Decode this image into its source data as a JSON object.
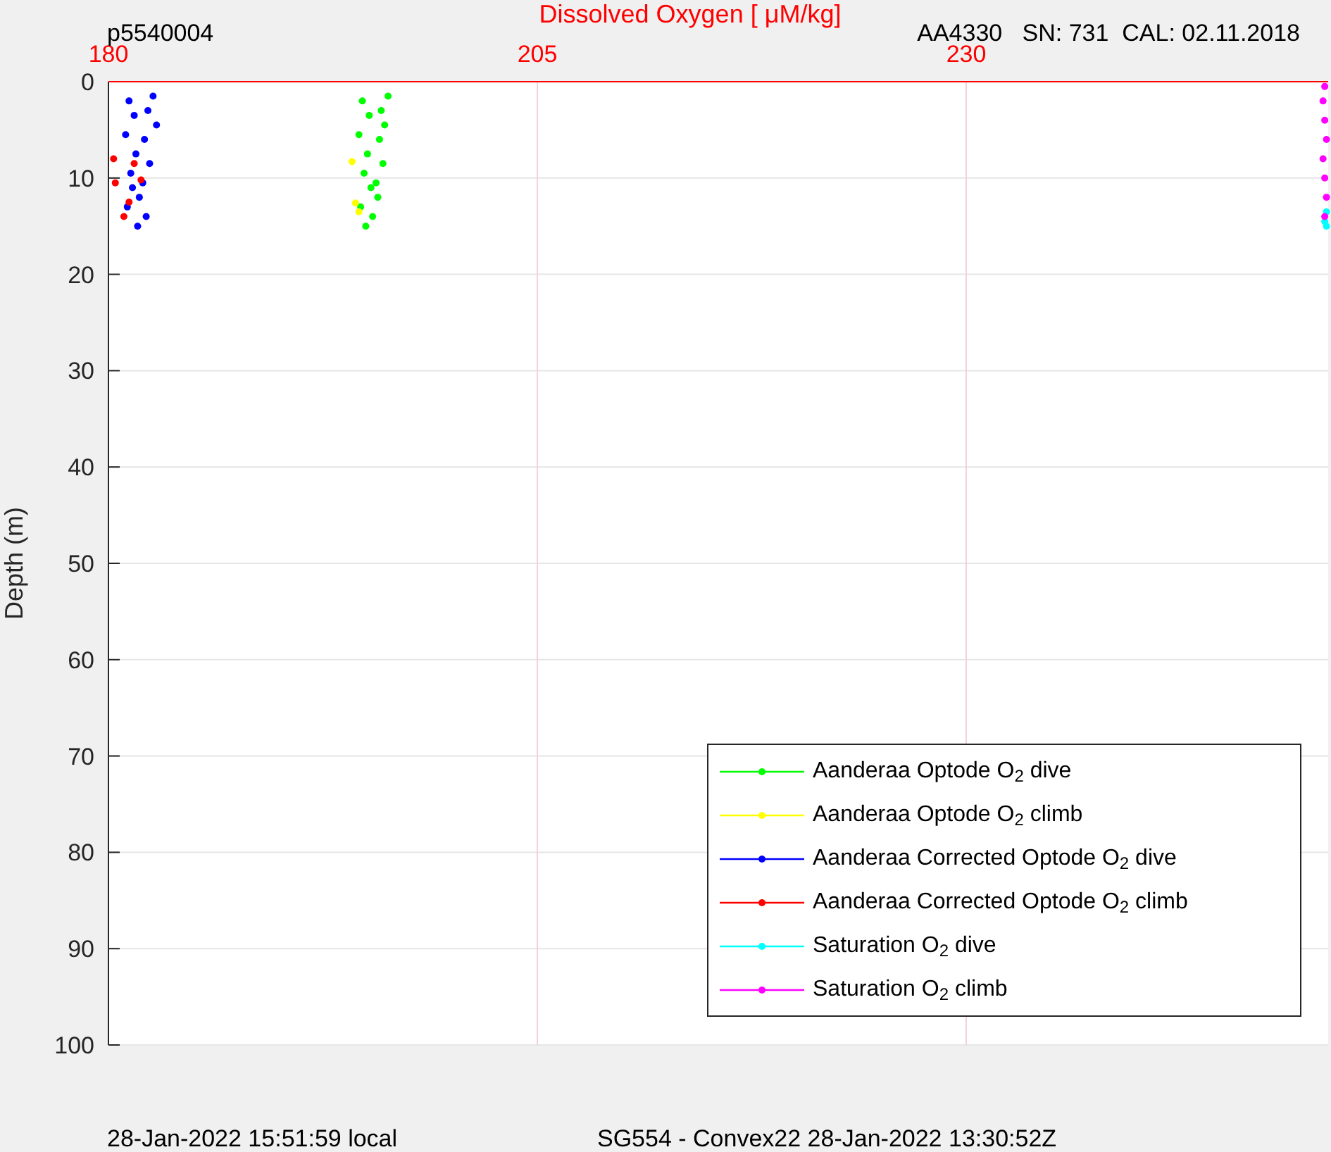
{
  "header": {
    "left": "p5540004",
    "right": "AA4330   SN: 731  CAL: 02.11.2018"
  },
  "chart_data": {
    "type": "scatter",
    "title": "Dissolved Oxygen [ μM/kg]",
    "ylabel": "Depth (m)",
    "xlim": [
      180,
      251.1
    ],
    "ylim": [
      100,
      0
    ],
    "xticks": [
      180,
      205,
      230
    ],
    "yticks": [
      0,
      10,
      20,
      30,
      40,
      50,
      60,
      70,
      80,
      90,
      100
    ],
    "grid": true,
    "legend": true,
    "series": [
      {
        "name": "Aanderaa Optode O$_{2}$ dive",
        "color": "#00ff00",
        "x": [
          196.3,
          194.8,
          195.9,
          195.2,
          196.1,
          194.6,
          195.8,
          195.1,
          196.0,
          194.9,
          195.6,
          195.3,
          195.7,
          194.7,
          195.4,
          195.0
        ],
        "values": [
          1.5,
          2.0,
          3.0,
          3.5,
          4.5,
          5.5,
          6.0,
          7.5,
          8.5,
          9.5,
          10.5,
          11.0,
          12.0,
          13.0,
          14.0,
          15.0
        ]
      },
      {
        "name": "Aanderaa Optode O$_{2}$ climb",
        "color": "#ffff00",
        "x": [
          194.2,
          194.4,
          194.6
        ],
        "values": [
          8.3,
          12.6,
          13.5
        ]
      },
      {
        "name": "Aanderaa Corrected Optode O$_{2}$ dive",
        "color": "#0000ff",
        "x": [
          182.6,
          181.2,
          182.3,
          181.5,
          182.8,
          181.0,
          182.1,
          181.6,
          182.4,
          181.3,
          182.0,
          181.4,
          181.8,
          181.1,
          182.2,
          181.7
        ],
        "values": [
          1.5,
          2.0,
          3.0,
          3.5,
          4.5,
          5.5,
          6.0,
          7.5,
          8.5,
          9.5,
          10.5,
          11.0,
          12.0,
          13.0,
          14.0,
          15.0
        ]
      },
      {
        "name": "Aanderaa Corrected Optode O$_{2}$ climb",
        "color": "#ff0000",
        "x": [
          180.3,
          181.5,
          180.4,
          181.9,
          181.2,
          180.9
        ],
        "values": [
          8.0,
          8.5,
          10.5,
          10.2,
          12.5,
          14.0
        ]
      },
      {
        "name": "Saturation O$_{2}$ dive",
        "color": "#00ffff",
        "x": [
          251.0,
          250.9,
          251.0
        ],
        "values": [
          13.5,
          14.5,
          15.0
        ]
      },
      {
        "name": "Saturation O$_{2}$ climb",
        "color": "#ff00ff",
        "x": [
          250.9,
          250.8,
          250.9,
          251.0,
          250.8,
          250.9,
          251.0,
          250.9
        ],
        "values": [
          0.5,
          2,
          4,
          6,
          8,
          10,
          12,
          14
        ]
      }
    ]
  },
  "footer": {
    "left": "28-Jan-2022 15:51:59 local",
    "right": "SG554 - Convex22 28-Jan-2022 13:30:52Z"
  }
}
